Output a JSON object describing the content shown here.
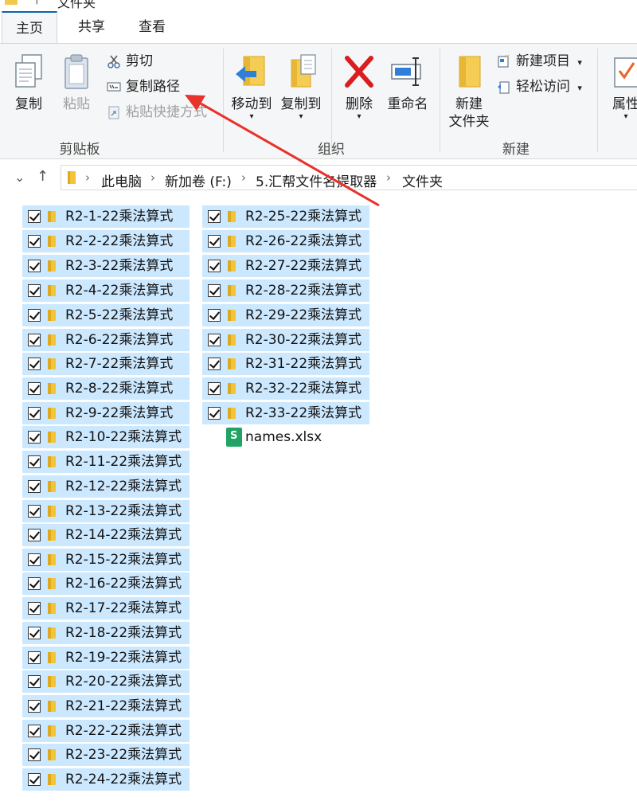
{
  "window": {
    "title": "文件夹"
  },
  "tabs": [
    {
      "label": "主页"
    },
    {
      "label": "共享"
    },
    {
      "label": "查看"
    }
  ],
  "ribbon": {
    "clipboard": {
      "copy": "复制",
      "paste": "粘贴",
      "cut": "剪切",
      "copy_path": "复制路径",
      "paste_shortcut": "粘贴快捷方式",
      "group": "剪贴板"
    },
    "organize": {
      "move_to": "移动到",
      "copy_to": "复制到",
      "delete": "删除",
      "rename": "重命名",
      "group": "组织"
    },
    "new": {
      "new_folder_line1": "新建",
      "new_folder_line2": "文件夹",
      "new_item": "新建项目",
      "easy_access": "轻松访问",
      "group": "新建"
    },
    "open": {
      "properties": "属性"
    }
  },
  "breadcrumb": [
    "此电脑",
    "新加卷 (F:)",
    "5.汇帮文件名提取器",
    "文件夹"
  ],
  "files": {
    "col1": [
      "R2-1-22乘法算式",
      "R2-2-22乘法算式",
      "R2-3-22乘法算式",
      "R2-4-22乘法算式",
      "R2-5-22乘法算式",
      "R2-6-22乘法算式",
      "R2-7-22乘法算式",
      "R2-8-22乘法算式",
      "R2-9-22乘法算式",
      "R2-10-22乘法算式",
      "R2-11-22乘法算式",
      "R2-12-22乘法算式",
      "R2-13-22乘法算式",
      "R2-14-22乘法算式",
      "R2-15-22乘法算式",
      "R2-16-22乘法算式",
      "R2-17-22乘法算式",
      "R2-18-22乘法算式",
      "R2-19-22乘法算式",
      "R2-20-22乘法算式",
      "R2-21-22乘法算式",
      "R2-22-22乘法算式",
      "R2-23-22乘法算式",
      "R2-24-22乘法算式"
    ],
    "col2": [
      "R2-25-22乘法算式",
      "R2-26-22乘法算式",
      "R2-27-22乘法算式",
      "R2-28-22乘法算式",
      "R2-29-22乘法算式",
      "R2-30-22乘法算式",
      "R2-31-22乘法算式",
      "R2-32-22乘法算式",
      "R2-33-22乘法算式"
    ],
    "xlsx_name": "names.xlsx",
    "xlsx_icon_letter": "S"
  },
  "colors": {
    "selection": "#cce8ff",
    "folder": "#f0c43b",
    "accent": "#0a64ad",
    "arrow": "#e8322c"
  }
}
